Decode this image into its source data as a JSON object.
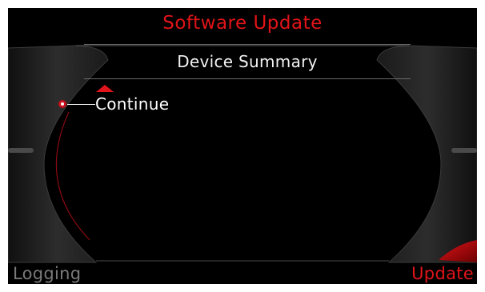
{
  "screen": {
    "title": "Software Update",
    "header": "Device Summary"
  },
  "menu": {
    "items": [
      {
        "label": "Continue",
        "selected": true
      }
    ]
  },
  "softkeys": {
    "left": "Logging",
    "right": "Update"
  },
  "colors": {
    "accent": "#e01418",
    "background": "#000000",
    "text": "#ffffff",
    "inactive": "#7a7a7a"
  },
  "icons": {
    "scroll_indicator": "triangle-up-icon",
    "selection_marker": "radio-dot-icon"
  }
}
